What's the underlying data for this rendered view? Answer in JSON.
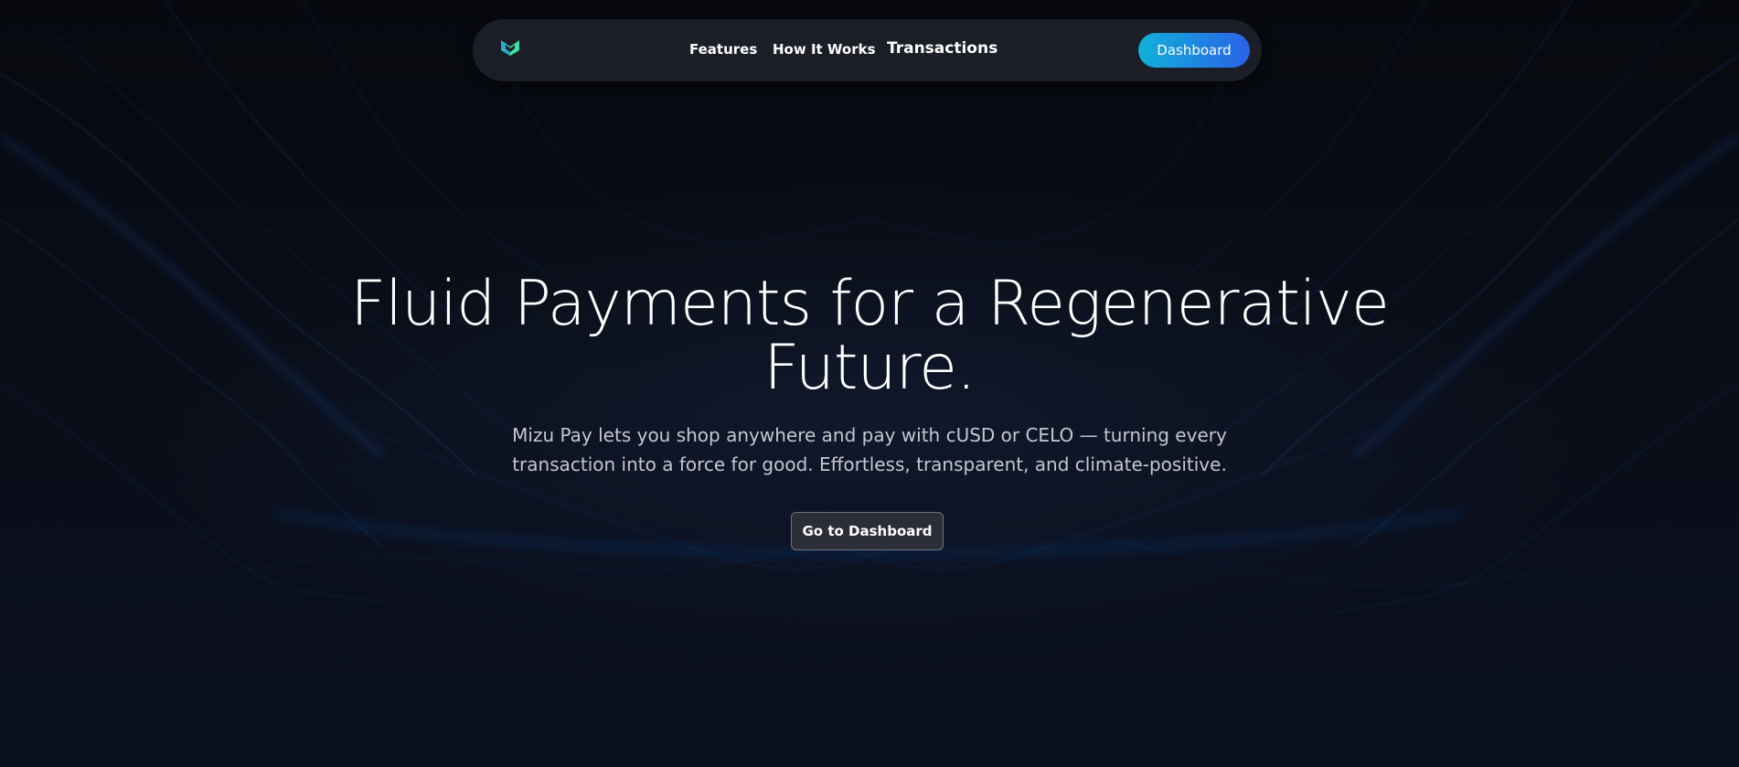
{
  "nav": {
    "logo_icon": "mizu-logo-icon",
    "links": [
      {
        "label": "Features"
      },
      {
        "label": "How It Works"
      },
      {
        "label": "Transactions"
      }
    ],
    "dashboard_label": "Dashboard"
  },
  "hero": {
    "headline_line1": "Fluid Payments for a Regenerative",
    "headline_line2": "Future.",
    "subtitle_line1": "Mizu Pay lets you shop anywhere and pay with cUSD or CELO — turning every",
    "subtitle_line2": "transaction into a force for good. Effortless, transparent, and climate-positive.",
    "cta_label": "Go to Dashboard"
  },
  "colors": {
    "background": "#090c14",
    "navbar": "#1b1e26",
    "accent_start": "#10b0d8",
    "accent_end": "#2a63e8",
    "logo_green": "#3fe0a3",
    "wave_blue": "#2a5bb8"
  }
}
